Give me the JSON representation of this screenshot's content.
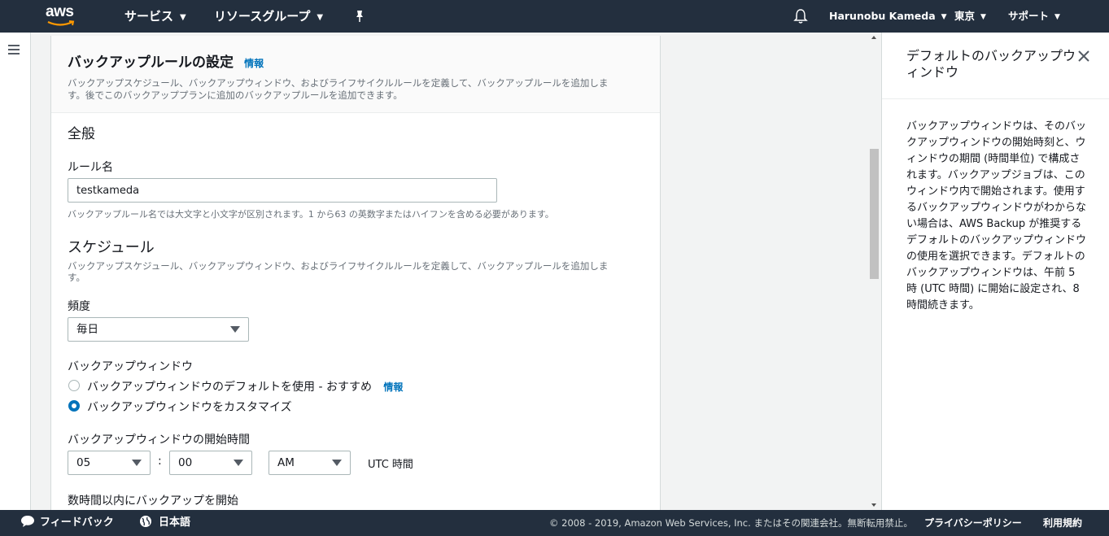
{
  "topnav": {
    "logo_text": "aws",
    "services": "サービス",
    "resource_groups": "リソースグループ",
    "user": "Harunobu Kameda",
    "region": "東京",
    "support": "サポート",
    "icons": [
      "pin-icon",
      "bell-icon",
      "chevron-down-icon"
    ]
  },
  "section": {
    "title": "バックアップルールの設定",
    "info": "情報",
    "description_line1": "バックアップスケジュール、バックアップウィンドウ、およびライフサイクルルールを定義して、バックアップルールを追加しま",
    "description_line2": "す。後でこのバックアッププランに追加のバックアップルールを追加できます。"
  },
  "general": {
    "heading": "全般",
    "rule_name_label": "ルール名",
    "rule_name_value": "testkameda",
    "rule_name_hint": "バックアップルール名では大文字と小文字が区別されます。1 から63 の英数字またはハイフンを含める必要があります。"
  },
  "schedule": {
    "heading": "スケジュール",
    "description_line1": "バックアップスケジュール、バックアップウィンドウ、およびライフサイクルルールを定義して、バックアップルールを追加しま",
    "description_line2": "す。",
    "frequency_label": "頻度",
    "frequency_value": "毎日",
    "window_label": "バックアップウィンドウ",
    "window_options": [
      {
        "label": "バックアップウィンドウのデフォルトを使用 - おすすめ",
        "info": "情報",
        "selected": false
      },
      {
        "label": "バックアップウィンドウをカスタマイズ",
        "selected": true
      }
    ],
    "start_time_label": "バックアップウィンドウの開始時間",
    "hour": "05",
    "separator": ":",
    "minute": "00",
    "ampm": "AM",
    "tz": "UTC 時間",
    "start_within_label": "数時間以内にバックアップを開始"
  },
  "help": {
    "title": "デフォルトのバックアップウィンドウ",
    "body": "バックアップウィンドウは、そのバックアップウィンドウの開始時刻と、ウィンドウの期間 (時間単位) で構成されます。バックアップジョブは、このウィンドウ内で開始されます。使用するバックアップウィンドウがわからない場合は、AWS Backup が推奨するデフォルトのバックアップウィンドウの使用を選択できます。デフォルトのバックアップウィンドウは、午前 5 時 (UTC 時間) に開始に設定され、8 時間続きます。"
  },
  "footer": {
    "feedback": "フィードバック",
    "language": "日本語",
    "copyright": "© 2008 - 2019, Amazon Web Services, Inc. またはその関連会社。無断転用禁止。",
    "privacy": "プライバシーポリシー",
    "terms": "利用規約"
  },
  "colors": {
    "nav_bg": "#232f3e",
    "link": "#0073bb",
    "accent": "#ff9900"
  }
}
